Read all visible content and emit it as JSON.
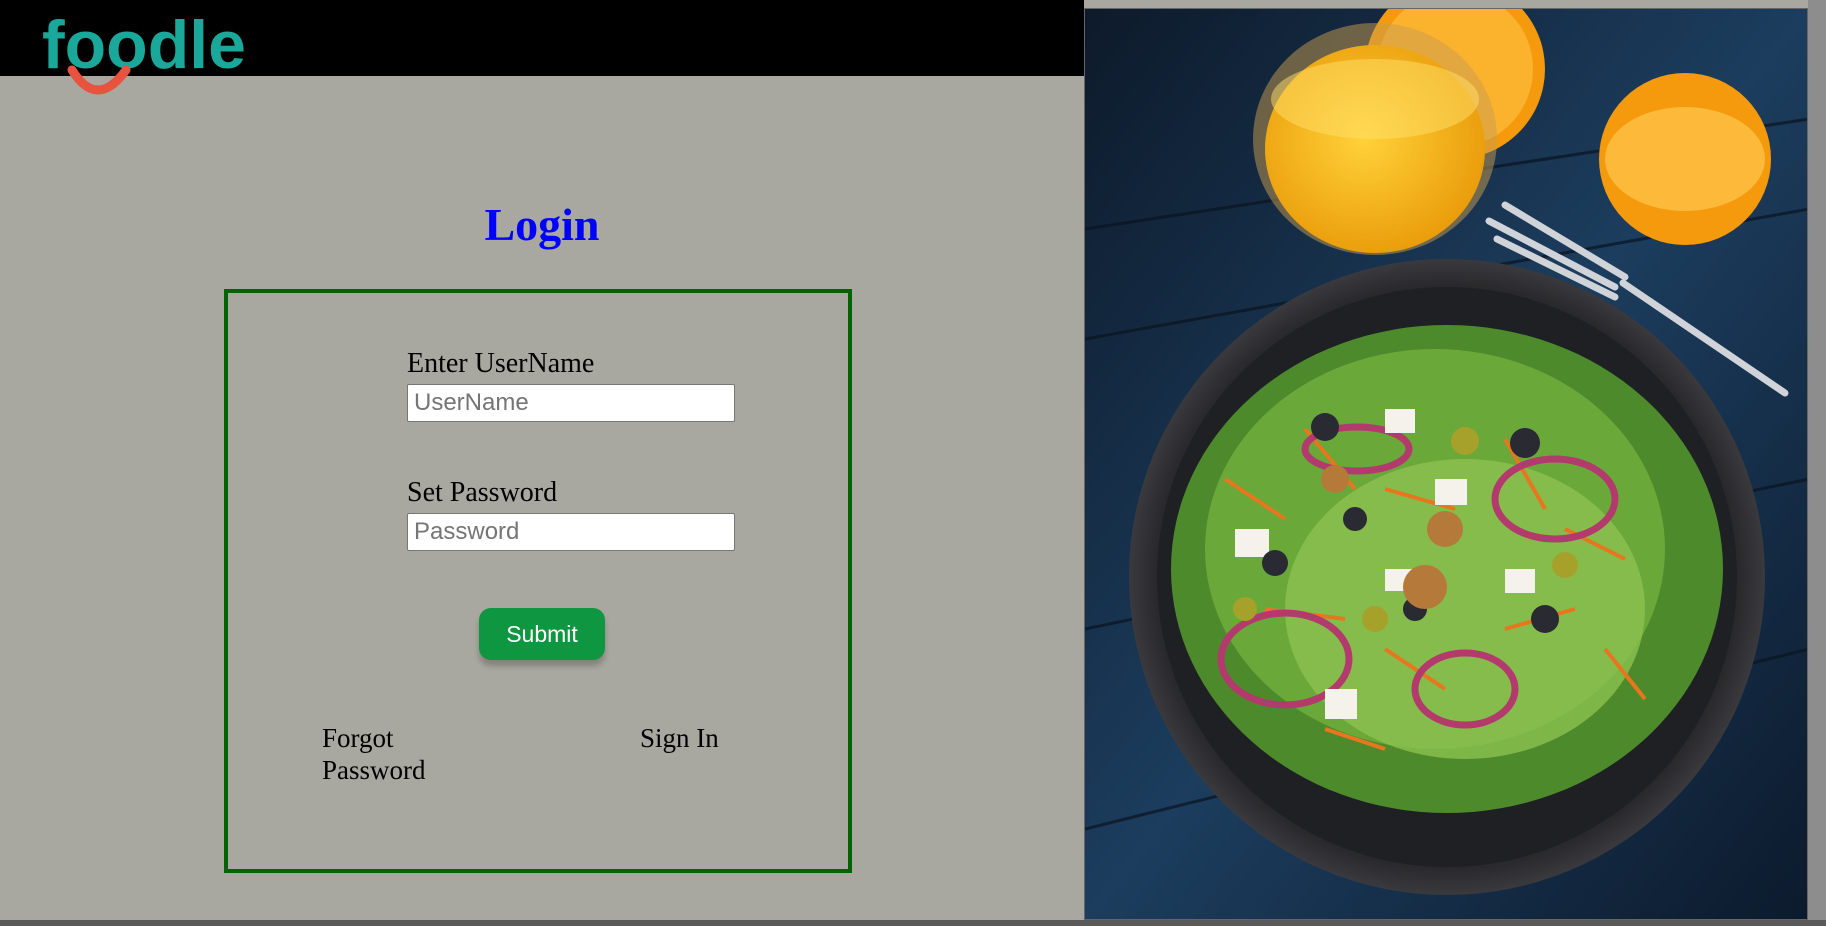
{
  "brand": {
    "name": "foodle",
    "text_color": "#1aa89a",
    "accent_color": "#e8533f"
  },
  "page": {
    "title": "Login",
    "title_color": "#0000ff",
    "background": "#a8a8a0"
  },
  "form": {
    "username": {
      "label": "Enter UserName",
      "placeholder": "UserName"
    },
    "password": {
      "label": "Set Password",
      "placeholder": "Password"
    },
    "submit_label": "Submit",
    "submit_color": "#0f9640",
    "border_color": "#006400"
  },
  "links": {
    "forgot_line1": "Forgot",
    "forgot_line2": "Password",
    "sign_in": "Sign In"
  },
  "hero": {
    "subject": "salad-with-orange-juice-photo"
  }
}
